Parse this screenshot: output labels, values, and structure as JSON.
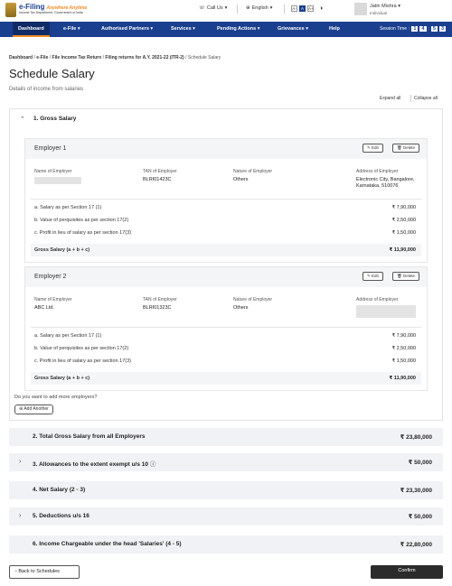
{
  "header": {
    "logo_title": "e-Filing",
    "logo_accent": "Anywhere Anytime",
    "logo_subtitle": "Income Tax Department, Government of India",
    "call_us": "Call Us",
    "language": "English",
    "font_small": "A-",
    "font_normal": "A",
    "font_large": "A+",
    "user_name": "Jatin Mishra",
    "user_role": "Individual"
  },
  "nav": {
    "items": [
      "Dashboard",
      "e-File",
      "Authorised Partners",
      "Services",
      "Pending Actions",
      "Grievances",
      "Help"
    ],
    "session_label": "Session Time",
    "session_digits": [
      "1",
      "4",
      "5",
      "3"
    ]
  },
  "breadcrumb": {
    "dashboard": "Dashboard",
    "efile": "e-File",
    "filing": "File Income Tax Return",
    "returns": "Filing returns for A.Y. 2021-22 (ITR-2)",
    "current": "Schedule Salary"
  },
  "page": {
    "title": "Schedule Salary",
    "subtitle": "Details of income from salaries",
    "expand_all": "Expand all",
    "collapse_all": "Collapse all"
  },
  "gross_salary": {
    "label": "1. Gross Salary",
    "employers": [
      {
        "title": "Employer 1",
        "name_label": "Name of Employer",
        "name_value": "",
        "tan_label": "TAN of Employer",
        "tan_value": "BLRI01423C",
        "nature_label": "Nature of Employer",
        "nature_value": "Others",
        "address_label": "Address of Employer",
        "address_value": "Electronic City, Bangalore, Karnataka, 510076",
        "items": [
          {
            "label": "a. Salary as per Section 17 (1)",
            "value": "₹ 7,90,000"
          },
          {
            "label": "b. Value of perquisites as per section 17(2)",
            "value": "₹ 2,50,000"
          },
          {
            "label": "c. Profit in lieu of salary as per section 17(3)",
            "value": "₹ 1,50,000"
          }
        ],
        "gross_label": "Gross Salary (a + b + c)",
        "gross_value": "₹ 11,90,000"
      },
      {
        "title": "Employer 2",
        "name_label": "Name of Employer",
        "name_value": "ABC Ltd.",
        "tan_label": "TAN of Employer",
        "tan_value": "BLRI01323C",
        "nature_label": "Nature of Employer",
        "nature_value": "Others",
        "address_label": "Address of Employer",
        "address_value": "",
        "items": [
          {
            "label": "a. Salary as per Section 17 (1)",
            "value": "₹ 7,90,000"
          },
          {
            "label": "b. Value of perquisites as per section 17(2)",
            "value": "₹ 2,50,000"
          },
          {
            "label": "c. Profit in lieu of salary as per section 17(3)",
            "value": "₹ 1,50,000"
          }
        ],
        "gross_label": "Gross Salary (a + b + c)",
        "gross_value": "₹ 11,90,000"
      }
    ],
    "edit_label": "Edit",
    "delete_label": "Delete",
    "more_question": "Do you want to add more employers?",
    "add_another": "Add Another"
  },
  "summary_rows": [
    {
      "label": "2. Total Gross Salary from all Employers",
      "value": "₹ 23,80,000",
      "expandable": false
    },
    {
      "label": "3. Allowances to the extent exempt u/s 10",
      "value": "₹ 50,000",
      "expandable": true
    },
    {
      "label": "4. Net Salary (2 - 3)",
      "value": "₹ 23,30,000",
      "expandable": false
    },
    {
      "label": "5. Deductions u/s 16",
      "value": "₹ 50,000",
      "expandable": true
    },
    {
      "label": "6. Income Chargeable under the head 'Salaries' (4 - 5)",
      "value": "₹ 22,80,000",
      "expandable": false
    }
  ],
  "footer": {
    "back_label": "Back to Schedules",
    "confirm_label": "Confirm"
  }
}
